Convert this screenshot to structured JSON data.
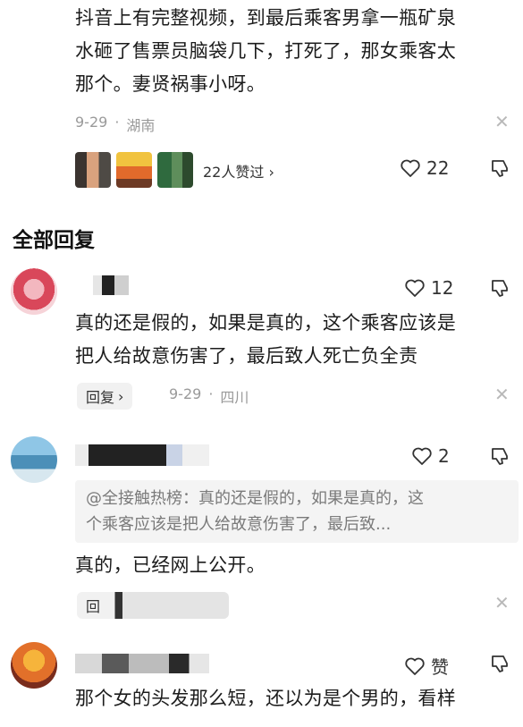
{
  "top_comment": {
    "text_line1": "抖音上有完整视频，到最后乘客男拿一瓶矿泉",
    "text_line2": "水砸了售票员脑袋几下，打死了，那女乘客太",
    "text_line3": "那个。妻贤祸事小呀。",
    "date": "9-29",
    "separator": "·",
    "location": "湖南",
    "likers_text": "22人赞过 ›",
    "like_count": "22"
  },
  "section_title": "全部回复",
  "replies": [
    {
      "like_count": "12",
      "text_line1": "真的还是假的，如果是真的，这个乘客应该是",
      "text_line2": "把人给故意伤害了，最后致人死亡负全责",
      "reply_label": "回复",
      "reply_arrow": "›",
      "date": "9-29",
      "separator": "·",
      "location": "四川"
    },
    {
      "like_count": "2",
      "quote_line1": "@全接触热榜：真的还是假的，如果是真的，这",
      "quote_line2": "个乘客应该是把人给故意伤害了，最后致...",
      "text": "真的，已经网上公开。",
      "reply_label": "回"
    },
    {
      "like_label": "赞",
      "text": "那个女的头发那么短，还以为是个男的，看样"
    }
  ],
  "colors": {
    "text": "#1c1c1c",
    "meta": "#9a9a9a",
    "quote_bg": "#f4f4f4"
  }
}
